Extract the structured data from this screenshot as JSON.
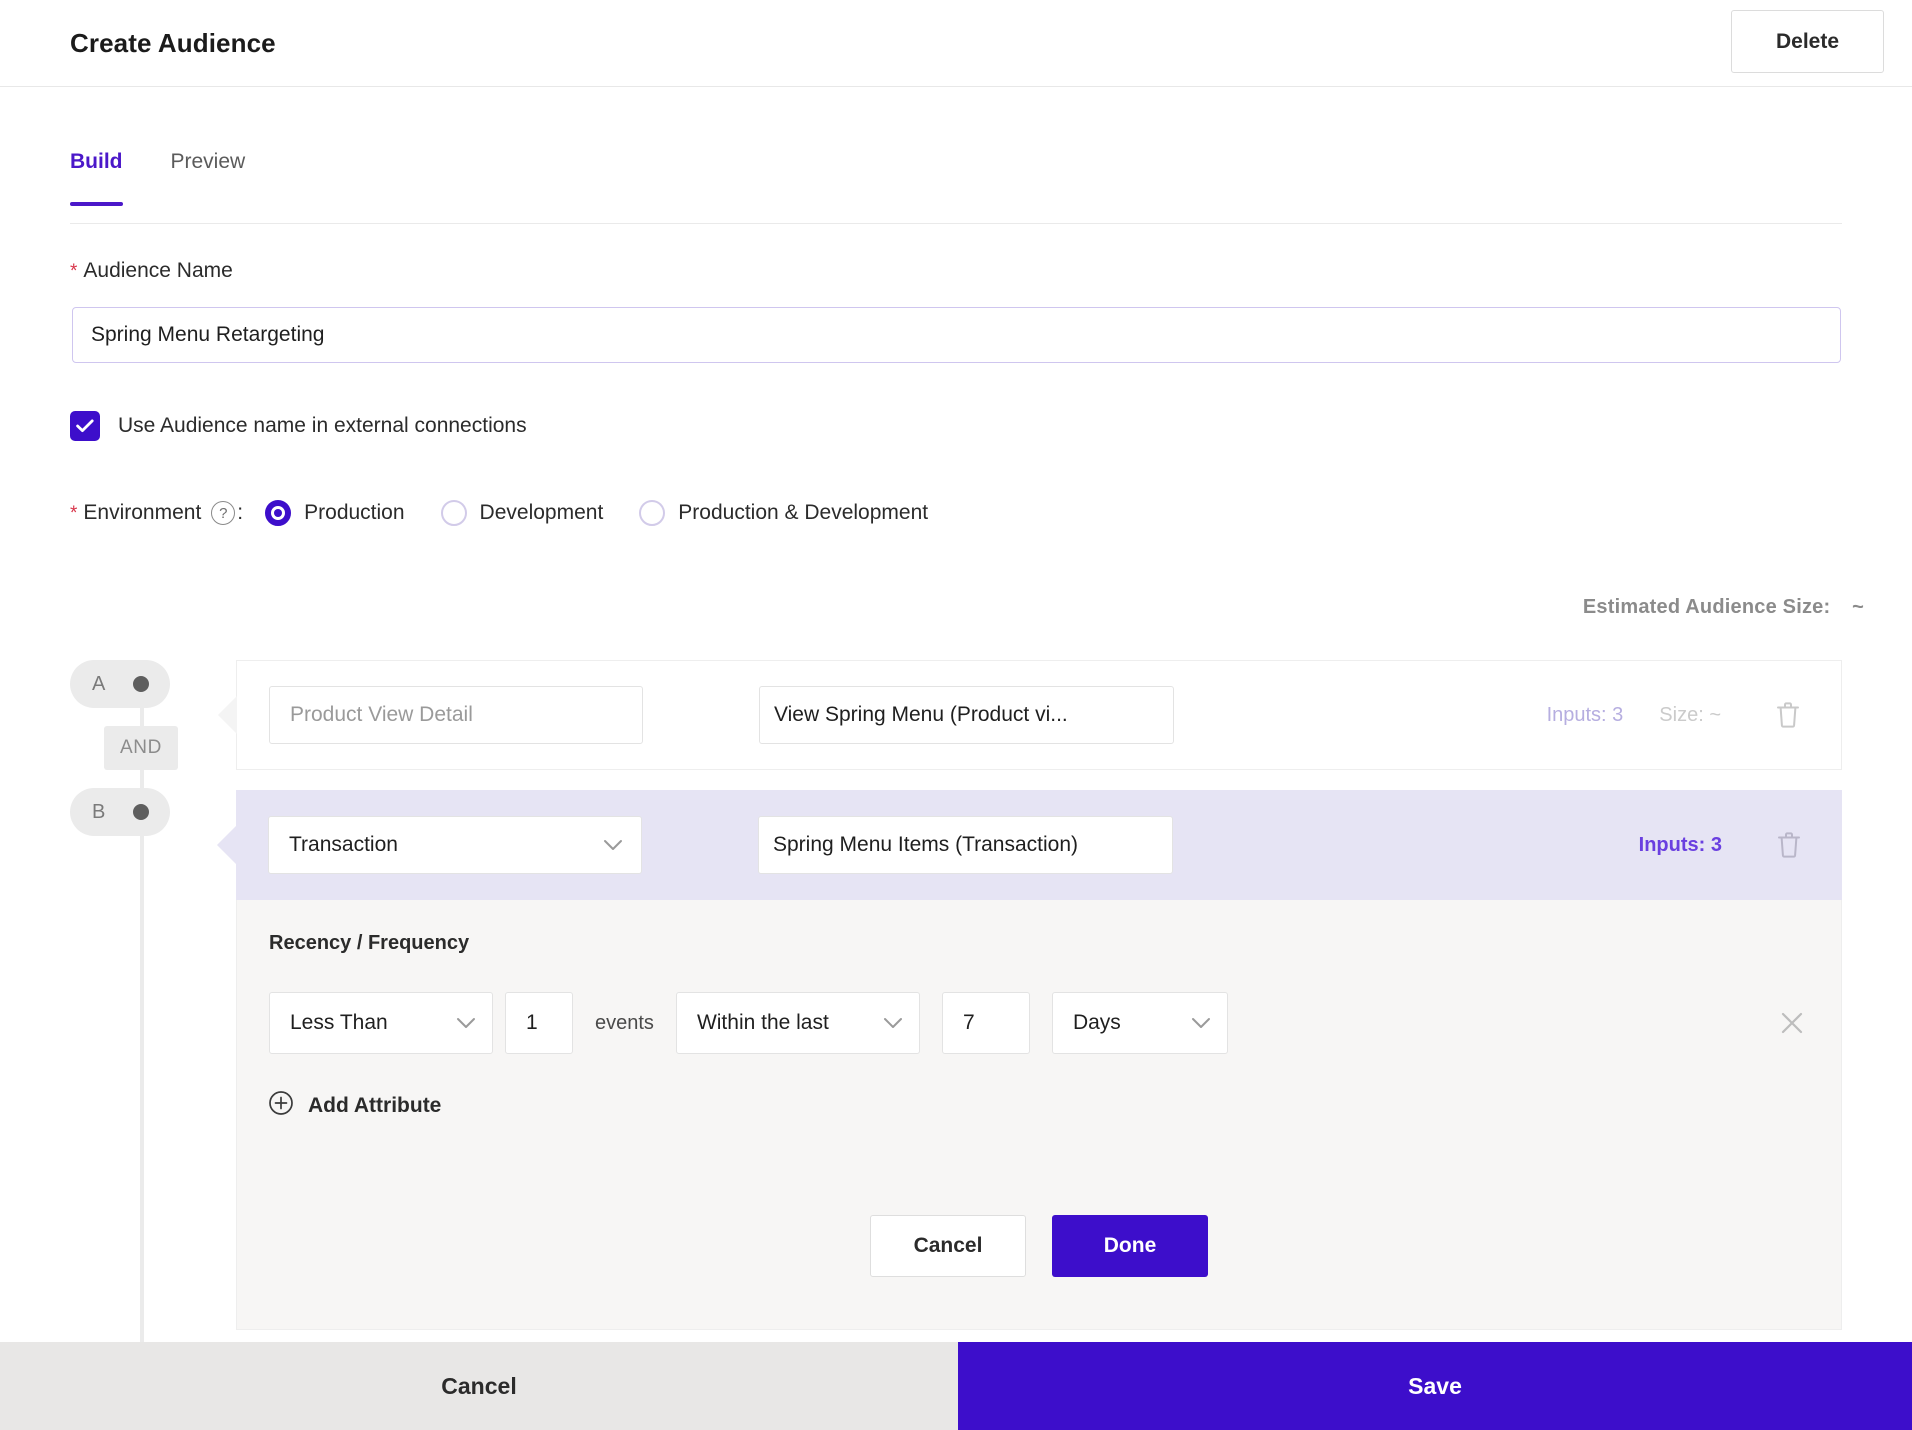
{
  "header": {
    "title": "Create Audience",
    "delete_label": "Delete"
  },
  "tabs": [
    {
      "label": "Build",
      "active": true
    },
    {
      "label": "Preview",
      "active": false
    }
  ],
  "audience_name": {
    "label": "Audience Name",
    "required_marker": "*",
    "value": "Spring Menu Retargeting",
    "placeholder": "Enter audience name"
  },
  "external_connections": {
    "label": "Use Audience name in external connections",
    "checked": true
  },
  "environment": {
    "label": "Environment",
    "required_marker": "*",
    "help_glyph": "?",
    "colon": ":",
    "options": [
      {
        "label": "Production",
        "selected": true
      },
      {
        "label": "Development",
        "selected": false
      },
      {
        "label": "Production & Development",
        "selected": false
      }
    ]
  },
  "estimated_size": {
    "label": "Estimated Audience Size:",
    "value": "~"
  },
  "builder": {
    "nodes": [
      {
        "letter": "A"
      },
      {
        "letter": "B"
      }
    ],
    "operator": "AND",
    "rules": [
      {
        "id": "A",
        "type_placeholder": "Product View Detail",
        "type_value": "",
        "value_text": "View Spring Menu (Product vi...",
        "inputs_label": "Inputs: 3",
        "size_label": "Size: ~",
        "trash_icon": "trash-icon",
        "selected": false
      },
      {
        "id": "B",
        "type_placeholder": "",
        "type_value": "Transaction",
        "value_text": "Spring Menu Items (Transaction)",
        "inputs_label": "Inputs: 3",
        "size_label": "",
        "trash_icon": "trash-icon",
        "selected": true
      }
    ],
    "detail": {
      "title": "Recency / Frequency",
      "operator": "Less Than",
      "count": "1",
      "events_label": "events",
      "window": "Within the last",
      "window_value": "7",
      "unit": "Days",
      "remove_icon": "close-icon"
    },
    "add_attribute_label": "Add Attribute",
    "panel_cancel_label": "Cancel",
    "panel_done_label": "Done"
  },
  "footer": {
    "cancel_label": "Cancel",
    "save_label": "Save"
  },
  "colors": {
    "accent": "#3d0ecb",
    "tab_active": "#4b18c9",
    "required": "#d8354a",
    "row_selected_bg": "#e6e4f4",
    "panel_bg": "#f7f6f5",
    "footer_cancel_bg": "#e8e7e6"
  }
}
